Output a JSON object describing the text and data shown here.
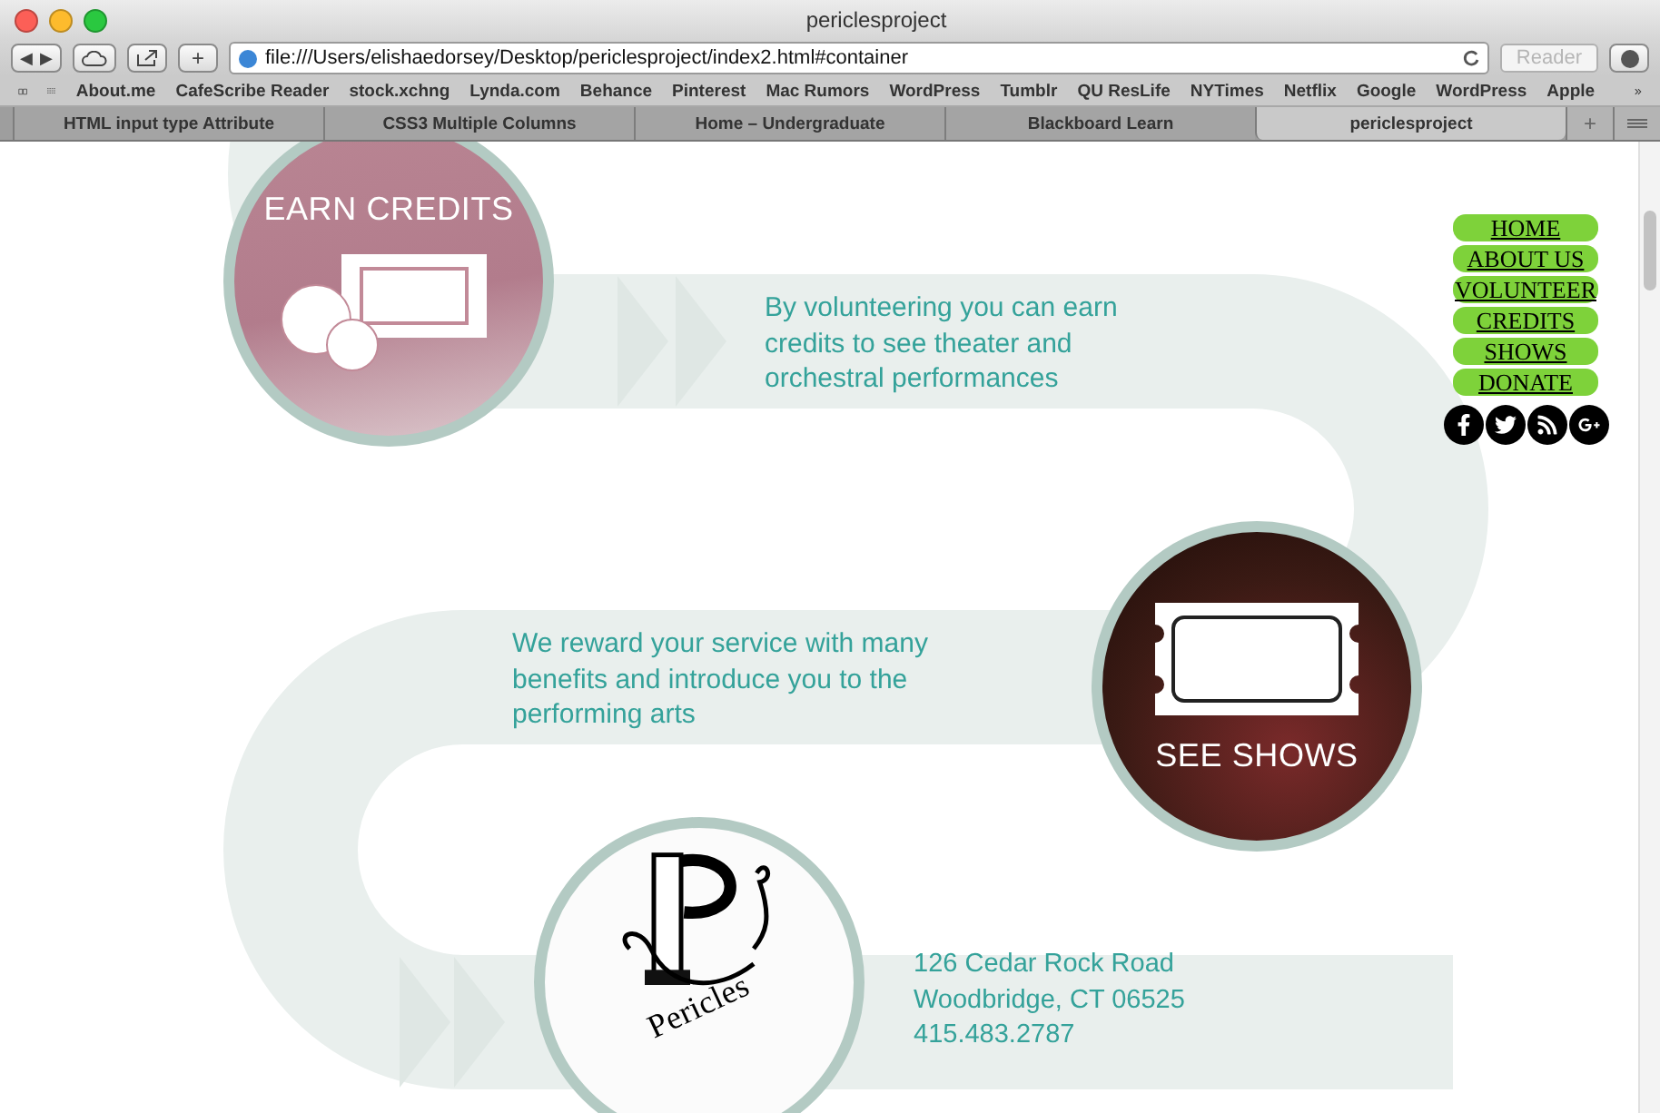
{
  "window": {
    "title": "periclesproject"
  },
  "toolbar": {
    "back": "◀",
    "forward": "▶",
    "url": "file:///Users/elishaedorsey/Desktop/periclesproject/index2.html#container",
    "reader": "Reader",
    "new_tab": "+"
  },
  "bookmarks": [
    "About.me",
    "CafeScribe Reader",
    "stock.xchng",
    "Lynda.com",
    "Behance",
    "Pinterest",
    "Mac Rumors",
    "WordPress",
    "Tumblr",
    "QU ResLife",
    "NYTimes",
    "Netflix",
    "Google",
    "WordPress",
    "Apple"
  ],
  "tabs": [
    {
      "label": "HTML input type Attribute",
      "selected": false
    },
    {
      "label": "CSS3 Multiple Columns",
      "selected": false
    },
    {
      "label": "Home – Undergraduate",
      "selected": false
    },
    {
      "label": "Blackboard Learn",
      "selected": false
    },
    {
      "label": "periclesproject",
      "selected": true
    }
  ],
  "add_tab": "+",
  "page": {
    "nav": [
      "HOME",
      "ABOUT US",
      "VOLUNTEER",
      "CREDITS",
      "SHOWS",
      "DONATE"
    ],
    "sections": [
      {
        "kind": "credits",
        "caption": "EARN CREDITS",
        "text": "By volunteering you can earn credits to see theater and orchestral performances"
      },
      {
        "kind": "shows",
        "caption": "SEE SHOWS",
        "text": "We reward your service with many benefits and introduce you to the performing arts"
      },
      {
        "kind": "logo",
        "caption": "Pericles",
        "lines": [
          "126 Cedar Rock Road",
          "Woodbridge, CT 06525",
          "415.483.2787"
        ]
      }
    ]
  }
}
